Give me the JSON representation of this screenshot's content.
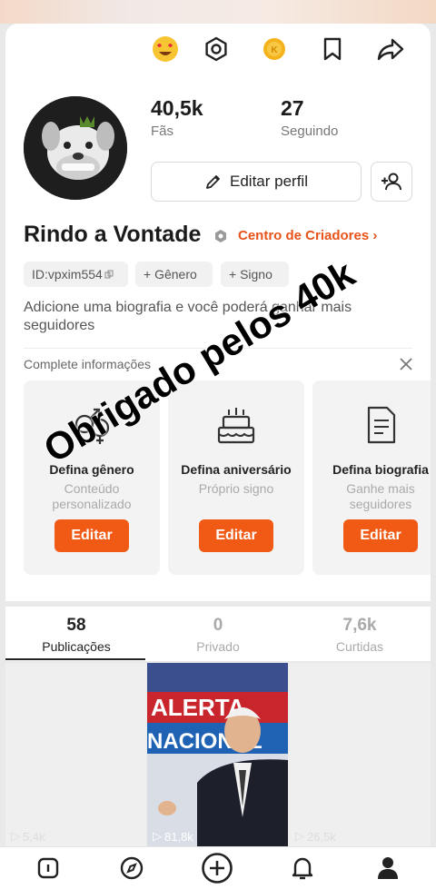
{
  "stats": {
    "fans_count": "40,5k",
    "fans_label": "Fãs",
    "following_count": "27",
    "following_label": "Seguindo"
  },
  "actions": {
    "edit_profile_label": "Editar perfil"
  },
  "profile": {
    "name": "Rindo a Vontade",
    "creator_center_label": "Centro de Criadores",
    "chips": {
      "id": "ID:vpxim554",
      "gender": "+ Gênero",
      "sign": "+ Signo"
    },
    "bio_placeholder": "Adicione uma biografia e você poderá ganhar mais seguidores"
  },
  "complete_info": {
    "title": "Complete informações",
    "tasks": [
      {
        "title": "Defina gênero",
        "subtitle": "Conteúdo personalizado",
        "button": "Editar",
        "icon": "gender-icon"
      },
      {
        "title": "Defina aniversário",
        "subtitle": "Próprio signo",
        "button": "Editar",
        "icon": "cake-icon"
      },
      {
        "title": "Defina biografia",
        "subtitle": "Ganhe mais seguidores",
        "button": "Editar",
        "icon": "document-icon"
      }
    ]
  },
  "tabs": [
    {
      "count": "58",
      "label": "Publicações"
    },
    {
      "count": "0",
      "label": "Privado"
    },
    {
      "count": "7,6k",
      "label": "Curtidas"
    }
  ],
  "videos": [
    {
      "views": "5,4k"
    },
    {
      "views": "81,8k",
      "banner_top": "ALERTA",
      "banner_bottom": "NACIONAL"
    },
    {
      "views": "26,5k"
    }
  ],
  "overlay_text": "Obrigado pelos 40k",
  "colors": {
    "accent": "#f05a15",
    "creator_link": "#e8531a"
  },
  "bottom_nav": [
    "home-icon",
    "discover-icon",
    "create-icon",
    "notifications-icon",
    "profile-icon"
  ]
}
